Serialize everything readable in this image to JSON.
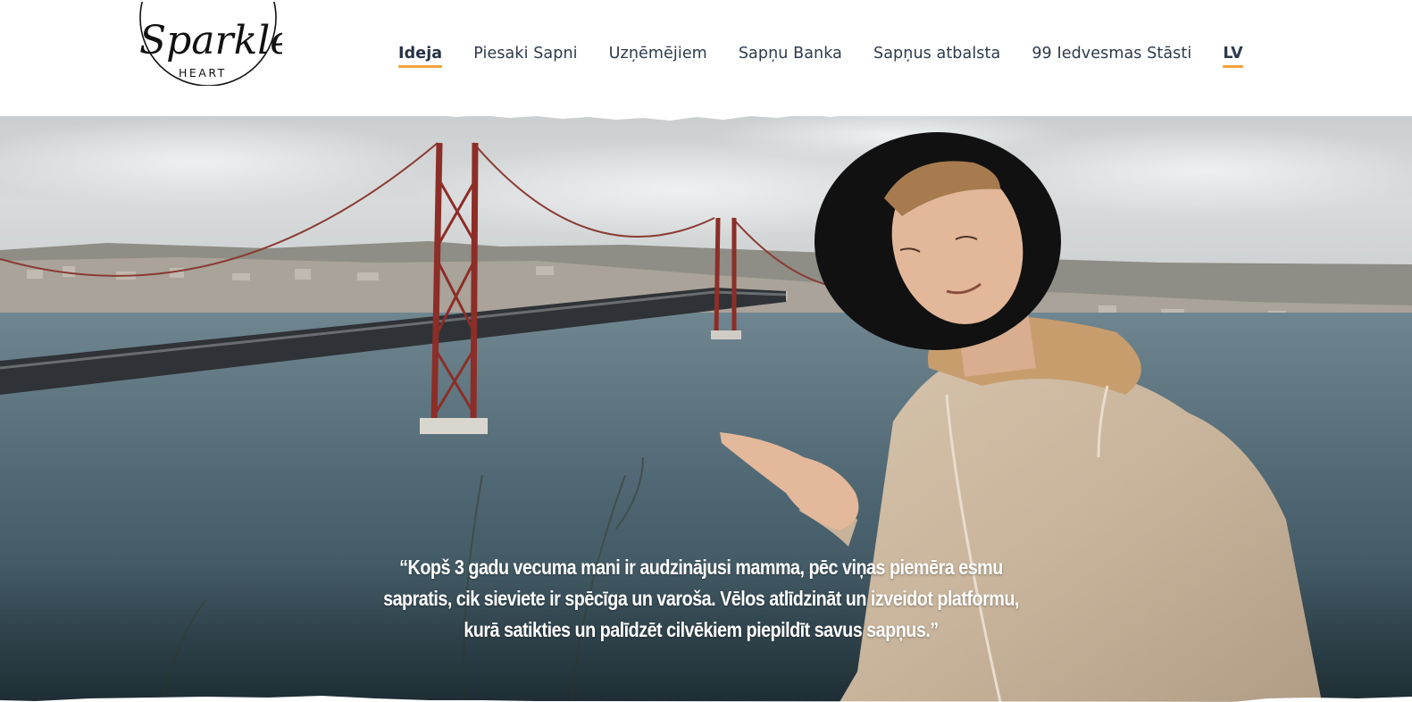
{
  "header": {
    "logo": {
      "script_text": "Sparkle",
      "sub_text": "HEART"
    },
    "nav": {
      "items": [
        {
          "label": "Ideja",
          "active": true
        },
        {
          "label": "Piesaki Sapni",
          "active": false
        },
        {
          "label": "Uzņēmējiem",
          "active": false
        },
        {
          "label": "Sapņu Banka",
          "active": false
        },
        {
          "label": "Sapņus atbalsta",
          "active": false
        },
        {
          "label": "99 Iedvesmas Stāsti",
          "active": false
        }
      ],
      "language": "LV"
    }
  },
  "hero": {
    "quote": "“Kopš 3 gadu vecuma mani ir audzinājusi mamma, pēc viņas piemēra esmu sapratis, cik sieviete ir spēcīga un varoša. Vēlos atlīdzināt un izveidot platformu, kurā satikties un palīdzēt cilvēkiem piepildīt savus sapņus.”"
  },
  "colors": {
    "accent_underline": "#f2a23a",
    "nav_text": "#2e3a4c",
    "quote_text": "#ffffff"
  }
}
